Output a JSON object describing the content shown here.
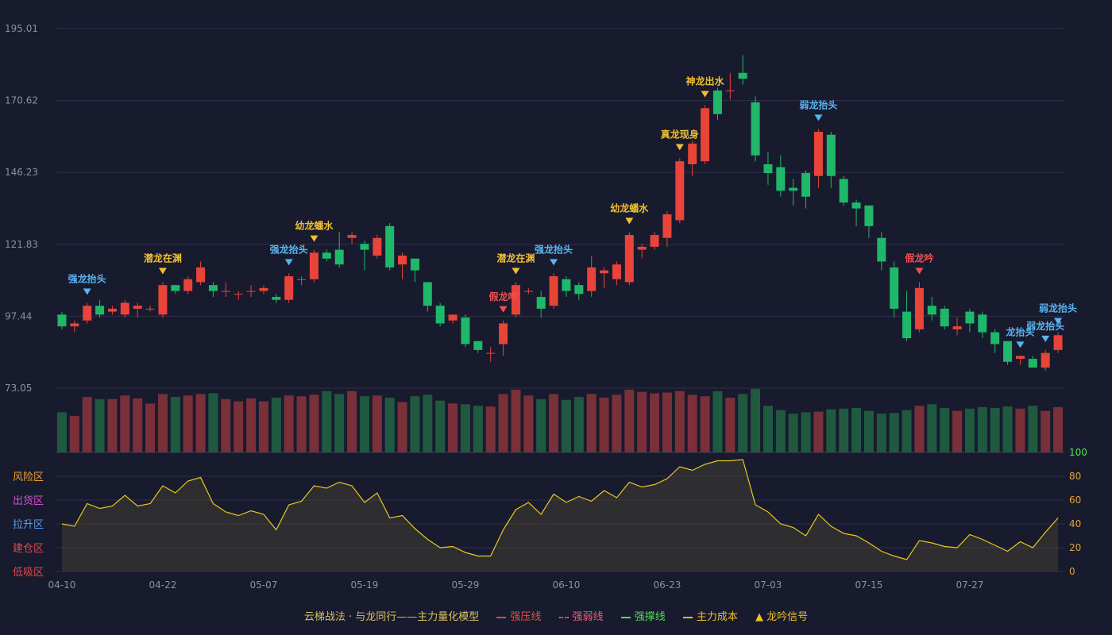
{
  "chart_data": {
    "type": "candlestick",
    "y_ticks": [
      "195.01",
      "170.62",
      "146.23",
      "121.83",
      "97.44",
      "73.05"
    ],
    "ylim": [
      73.05,
      195.01
    ],
    "x_ticks": [
      {
        "label": "04-10",
        "i": 0
      },
      {
        "label": "04-22",
        "i": 8
      },
      {
        "label": "05-07",
        "i": 16
      },
      {
        "label": "05-19",
        "i": 24
      },
      {
        "label": "05-29",
        "i": 32
      },
      {
        "label": "06-10",
        "i": 40
      },
      {
        "label": "06-23",
        "i": 48
      },
      {
        "label": "07-03",
        "i": 56
      },
      {
        "label": "07-15",
        "i": 64
      },
      {
        "label": "07-27",
        "i": 72
      }
    ],
    "candles": [
      [
        98,
        94,
        99,
        93
      ],
      [
        94,
        95,
        96,
        92
      ],
      [
        96,
        101,
        102,
        95
      ],
      [
        101,
        98,
        103,
        97
      ],
      [
        99,
        100,
        101,
        98
      ],
      [
        98,
        102,
        103,
        97
      ],
      [
        100,
        101,
        102,
        97
      ],
      [
        100,
        100,
        101,
        99
      ],
      [
        98,
        108,
        109,
        97
      ],
      [
        108,
        106,
        108,
        105
      ],
      [
        106,
        110,
        111,
        105
      ],
      [
        109,
        114,
        116,
        108
      ],
      [
        108,
        106,
        109,
        104
      ],
      [
        106,
        106,
        109,
        104
      ],
      [
        105,
        105,
        106,
        103
      ],
      [
        106,
        106,
        108,
        104
      ],
      [
        106,
        107,
        108,
        105
      ],
      [
        104,
        103,
        105,
        102
      ],
      [
        103,
        111,
        112,
        102
      ],
      [
        110,
        110,
        111,
        108
      ],
      [
        110,
        119,
        120,
        109
      ],
      [
        119,
        117,
        120,
        116
      ],
      [
        120,
        115,
        126,
        114
      ],
      [
        124,
        125,
        126,
        122
      ],
      [
        122,
        120,
        123,
        113
      ],
      [
        118,
        124,
        125,
        117
      ],
      [
        128,
        114,
        129,
        113
      ],
      [
        115,
        118,
        119,
        110
      ],
      [
        117,
        113,
        117,
        109
      ],
      [
        109,
        101,
        109,
        99
      ],
      [
        101,
        95,
        102,
        94
      ],
      [
        96,
        98,
        98,
        95
      ],
      [
        97,
        88,
        98,
        87
      ],
      [
        89,
        86,
        89,
        85
      ],
      [
        85,
        85,
        87,
        82
      ],
      [
        88,
        95,
        96,
        84
      ],
      [
        98,
        108,
        109,
        97
      ],
      [
        106,
        106,
        107,
        105
      ],
      [
        104,
        100,
        106,
        97
      ],
      [
        101,
        111,
        112,
        100
      ],
      [
        110,
        106,
        111,
        104
      ],
      [
        108,
        105,
        109,
        103
      ],
      [
        106,
        114,
        118,
        104
      ],
      [
        112,
        113,
        114,
        107
      ],
      [
        110,
        115,
        116,
        108
      ],
      [
        109,
        125,
        126,
        108
      ],
      [
        120,
        121,
        122,
        117
      ],
      [
        121,
        125,
        126,
        120
      ],
      [
        124,
        132,
        133,
        121
      ],
      [
        130,
        150,
        151,
        129
      ],
      [
        149,
        156,
        157,
        145
      ],
      [
        150,
        168,
        169,
        149
      ],
      [
        174,
        166,
        175,
        164
      ],
      [
        174,
        174,
        180,
        171
      ],
      [
        180,
        178,
        186,
        176
      ],
      [
        170,
        152,
        172,
        150
      ],
      [
        149,
        146,
        153,
        142
      ],
      [
        148,
        140,
        152,
        138
      ],
      [
        141,
        140,
        144,
        135
      ],
      [
        146,
        138,
        147,
        134
      ],
      [
        145,
        160,
        161,
        141
      ],
      [
        159,
        145,
        160,
        141
      ],
      [
        144,
        136,
        145,
        135
      ],
      [
        136,
        134,
        137,
        128
      ],
      [
        135,
        128,
        135,
        124
      ],
      [
        124,
        116,
        126,
        113
      ],
      [
        114,
        100,
        116,
        97
      ],
      [
        99,
        90,
        106,
        89
      ],
      [
        93,
        107,
        109,
        92
      ],
      [
        101,
        98,
        104,
        96
      ],
      [
        100,
        94,
        101,
        93
      ],
      [
        93,
        94,
        97,
        91
      ],
      [
        99,
        95,
        100,
        92
      ],
      [
        98,
        92,
        99,
        90
      ],
      [
        92,
        88,
        93,
        85
      ],
      [
        89,
        82,
        89,
        81
      ],
      [
        83,
        84,
        84,
        81
      ],
      [
        83,
        80,
        84,
        80
      ],
      [
        80,
        85,
        86,
        79
      ],
      [
        86,
        91,
        92,
        85
      ]
    ],
    "volume": [
      55,
      50,
      76,
      73,
      73,
      78,
      74,
      67,
      80,
      76,
      78,
      80,
      81,
      73,
      70,
      74,
      70,
      75,
      78,
      77,
      79,
      84,
      80,
      84,
      77,
      78,
      75,
      69,
      77,
      79,
      71,
      67,
      66,
      64,
      63,
      80,
      86,
      78,
      73,
      80,
      72,
      76,
      80,
      75,
      79,
      86,
      83,
      81,
      82,
      84,
      79,
      77,
      84,
      75,
      80,
      87,
      64,
      58,
      53,
      55,
      56,
      59,
      60,
      61,
      57,
      53,
      54,
      58,
      64,
      66,
      61,
      57,
      60,
      62,
      61,
      63,
      60,
      64,
      57,
      62
    ],
    "indicator": [
      40,
      38,
      57,
      53,
      55,
      64,
      55,
      57,
      72,
      66,
      76,
      79,
      57,
      50,
      47,
      51,
      48,
      35,
      56,
      59,
      72,
      70,
      75,
      72,
      58,
      66,
      45,
      47,
      36,
      27,
      20,
      21,
      16,
      13,
      13,
      35,
      52,
      58,
      48,
      65,
      58,
      63,
      59,
      68,
      62,
      75,
      71,
      73,
      78,
      88,
      85,
      90,
      93,
      93,
      94,
      56,
      50,
      40,
      37,
      30,
      48,
      38,
      32,
      30,
      24,
      17,
      13,
      10,
      26,
      24,
      21,
      20,
      31,
      27,
      22,
      17,
      25,
      20,
      33,
      45
    ],
    "indicator_ticks": [
      "100",
      "80",
      "60",
      "40",
      "20",
      "0"
    ],
    "zones": [
      {
        "label": "风险区",
        "color": "#e8a030"
      },
      {
        "label": "出货区",
        "color": "#d050d0"
      },
      {
        "label": "拉升区",
        "color": "#5a9bf0"
      },
      {
        "label": "建仓区",
        "color": "#e04848"
      },
      {
        "label": "低吸区",
        "color": "#e04848"
      }
    ],
    "signals": [
      {
        "i": 2,
        "label": "强龙抬头",
        "color": "#5ab4f0"
      },
      {
        "i": 8,
        "label": "潜龙在渊",
        "color": "#f0c030"
      },
      {
        "i": 18,
        "label": "强龙抬头",
        "color": "#5ab4f0"
      },
      {
        "i": 20,
        "label": "幼龙蟠水",
        "color": "#f0c030"
      },
      {
        "i": 35,
        "label": "假龙吟",
        "color": "#f05050"
      },
      {
        "i": 36,
        "label": "潜龙在渊",
        "color": "#f0c030"
      },
      {
        "i": 39,
        "label": "强龙抬头",
        "color": "#5ab4f0"
      },
      {
        "i": 45,
        "label": "幼龙蟠水",
        "color": "#f0c030"
      },
      {
        "i": 49,
        "label": "真龙现身",
        "color": "#f0c030"
      },
      {
        "i": 51,
        "label": "神龙出水",
        "color": "#f0c030"
      },
      {
        "i": 60,
        "label": "弱龙抬头",
        "color": "#5ab4f0"
      },
      {
        "i": 68,
        "label": "假龙吟",
        "color": "#f05050"
      },
      {
        "i": 76,
        "label": "龙抬头",
        "color": "#5ab4f0"
      },
      {
        "i": 78,
        "label": "弱龙抬头",
        "color": "#5ab4f0"
      },
      {
        "i": 79,
        "label": "弱龙抬头",
        "color": "#5ab4f0"
      }
    ],
    "colors": {
      "up": "#e8443a",
      "down": "#1fb86a",
      "vol_up": "#7a3038",
      "vol_down": "#1f5a40",
      "line": "#e8c81e",
      "grid": "#2e3248"
    }
  },
  "legend": {
    "title": "云梯战法 · 与龙同行——主力量化模型",
    "items": [
      {
        "label": "强压线",
        "color": "#f04a40",
        "style": "solid"
      },
      {
        "label": "强弱线",
        "color": "#f06070",
        "style": "dotted"
      },
      {
        "label": "强撑线",
        "color": "#50e050",
        "style": "solid"
      },
      {
        "label": "主力成本",
        "color": "#f0c020",
        "style": "dashed"
      },
      {
        "label": "龙吟信号",
        "color": "#f0c020",
        "style": "triangle"
      }
    ]
  }
}
